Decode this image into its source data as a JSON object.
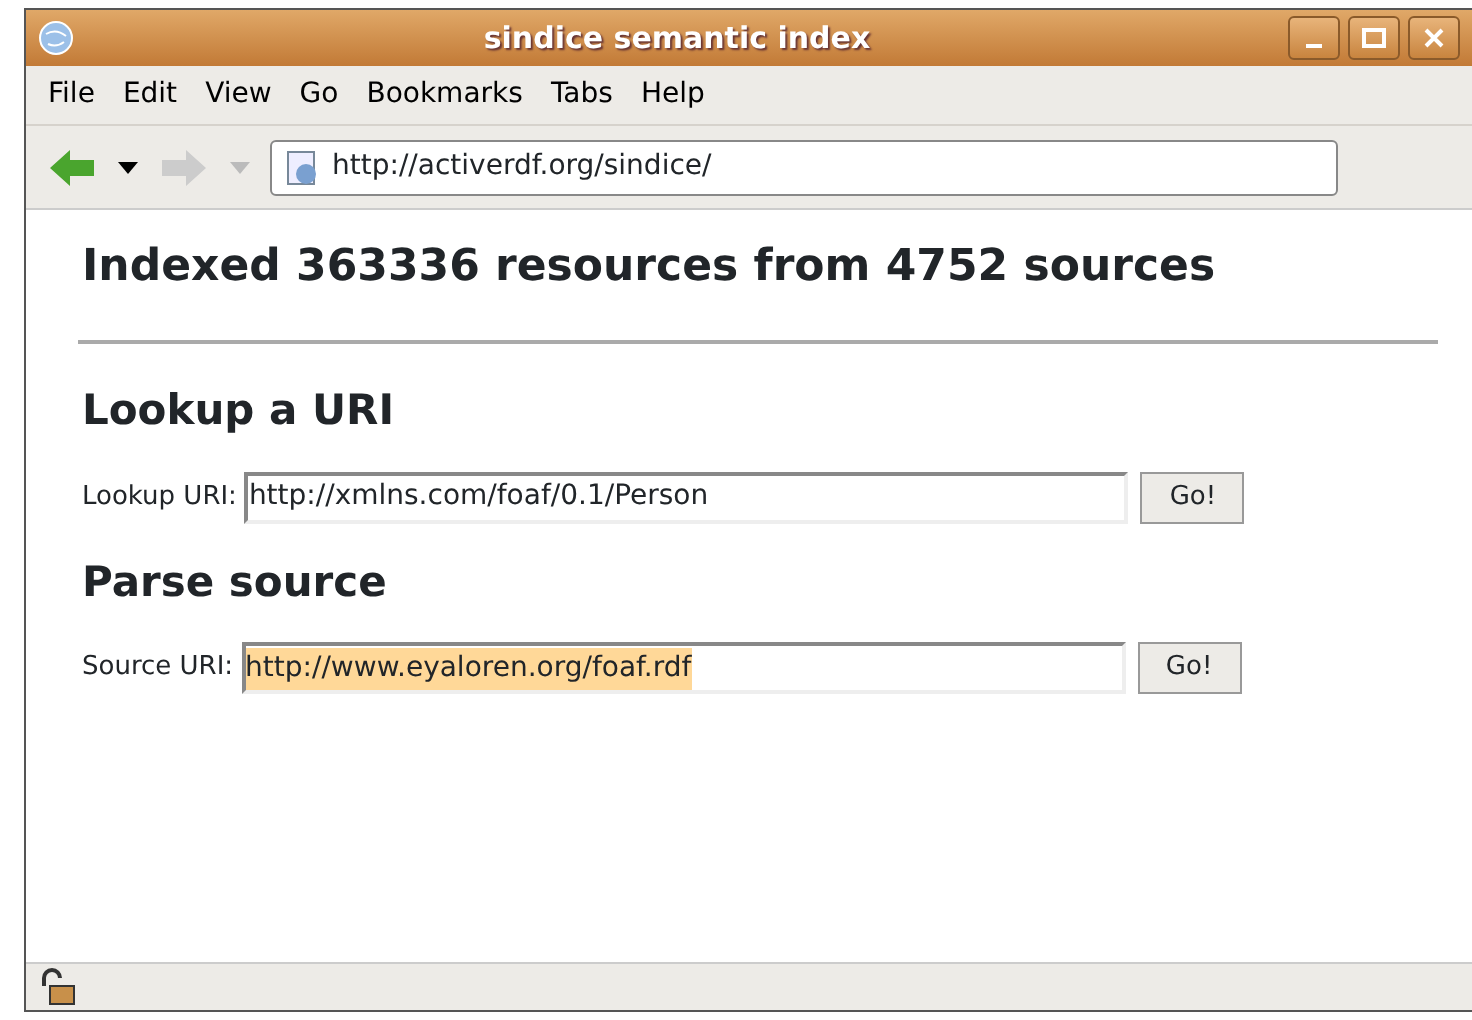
{
  "window": {
    "title": "sindice semantic index"
  },
  "menu": [
    "File",
    "Edit",
    "View",
    "Go",
    "Bookmarks",
    "Tabs",
    "Help"
  ],
  "toolbar": {
    "back_enabled": true,
    "forward_enabled": false,
    "address": "http://activerdf.org/sindice/"
  },
  "page": {
    "heading": "Indexed 363336 resources from 4752 sources",
    "sections": [
      {
        "title": "Lookup a URI",
        "label": "Lookup URI:",
        "value": "http://xmlns.com/foaf/0.1/Person",
        "text_selected": false,
        "button": "Go!"
      },
      {
        "title": "Parse source",
        "label": "Source URI:",
        "value": "http://www.eyaloren.org/foaf.rdf",
        "text_selected": true,
        "button": "Go!"
      }
    ]
  }
}
